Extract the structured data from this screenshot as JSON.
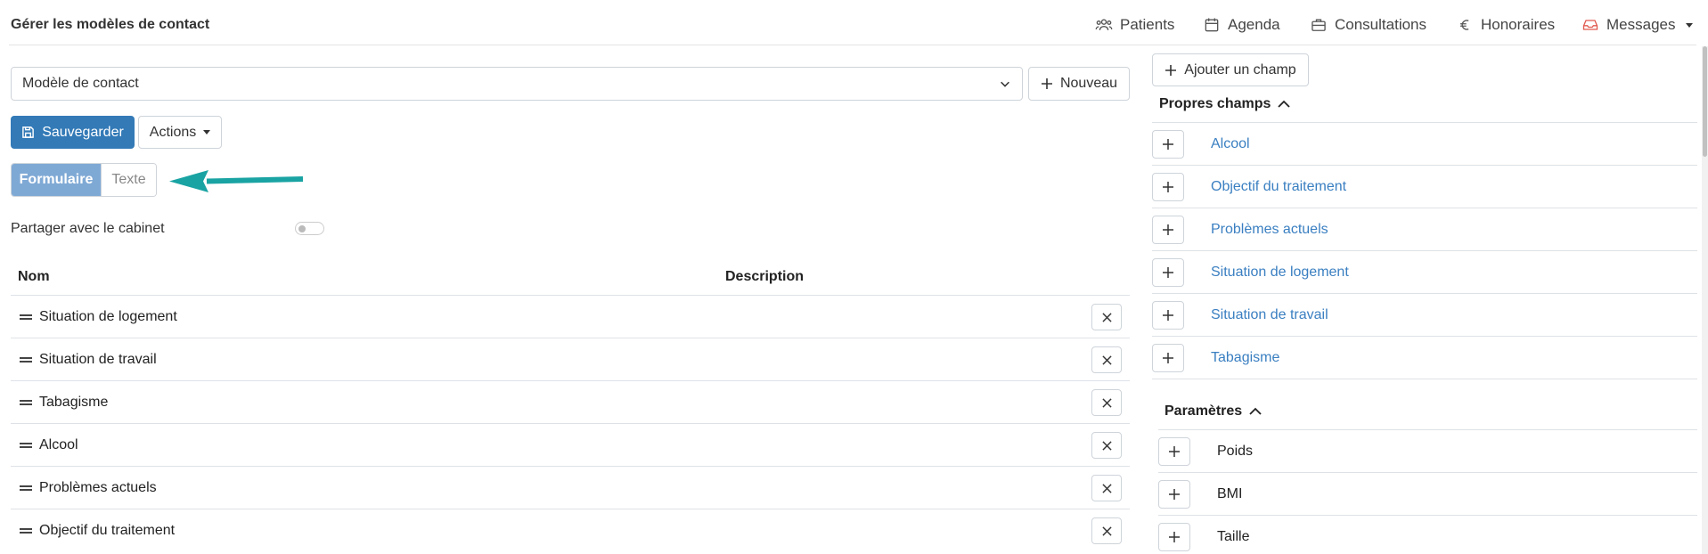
{
  "header": {
    "title": "Gérer les modèles de contact",
    "nav": [
      {
        "label": "Patients",
        "icon": "users-icon"
      },
      {
        "label": "Agenda",
        "icon": "calendar-icon"
      },
      {
        "label": "Consultations",
        "icon": "briefcase-icon"
      },
      {
        "label": "Honoraires",
        "icon": "euro-icon"
      },
      {
        "label": "Messages",
        "icon": "inbox-icon"
      }
    ],
    "accent_color": "#e05a4f"
  },
  "template": {
    "selected": "Modèle de contact",
    "new_label": "Nouveau"
  },
  "toolbar": {
    "save_label": "Sauvegarder",
    "actions_label": "Actions"
  },
  "mode": {
    "form_label": "Formulaire",
    "text_label": "Texte",
    "active": "Formulaire"
  },
  "share": {
    "label": "Partager avec le cabinet",
    "enabled": false
  },
  "table": {
    "columns": [
      "Nom",
      "Description"
    ],
    "rows": [
      {
        "name": "Situation de logement",
        "description": ""
      },
      {
        "name": "Situation de travail",
        "description": ""
      },
      {
        "name": "Tabagisme",
        "description": ""
      },
      {
        "name": "Alcool",
        "description": ""
      },
      {
        "name": "Problèmes actuels",
        "description": ""
      },
      {
        "name": "Objectif du traitement",
        "description": ""
      }
    ]
  },
  "right_panel": {
    "add_field_label": "Ajouter un champ",
    "own_fields_title": "Propres champs",
    "own_fields": [
      "Alcool",
      "Objectif du traitement",
      "Problèmes actuels",
      "Situation de logement",
      "Situation de travail",
      "Tabagisme"
    ],
    "params_title": "Paramètres",
    "params": [
      "Poids",
      "BMI",
      "Taille"
    ]
  },
  "colors": {
    "primary": "#337ab7",
    "segment_active": "#7fa9d5",
    "link": "#3a7fc1",
    "arrow": "#1aa3a3"
  }
}
